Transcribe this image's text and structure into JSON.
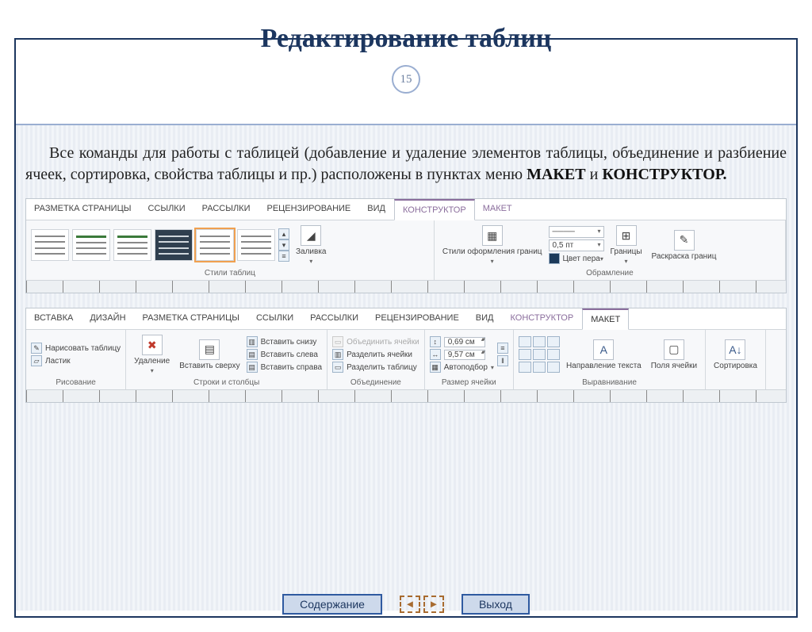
{
  "page_number": "15",
  "title": "Редактирование таблиц",
  "body_pre": "Все команды для работы с таблицей (добавление и удаление элементов таблицы, объединение и разбиение ячеек,  сортировка,  свойства таблицы и пр.) расположены в пунктах меню ",
  "body_bold1": "МАКЕТ",
  "body_mid": " и ",
  "body_bold2": "КОНСТРУКТОР.",
  "shot1": {
    "tabs": [
      "РАЗМЕТКА СТРАНИЦЫ",
      "ССЫЛКИ",
      "РАССЫЛКИ",
      "РЕЦЕНЗИРОВАНИЕ",
      "ВИД",
      "КОНСТРУКТОР",
      "МАКЕТ"
    ],
    "group_styles": "Стили таблиц",
    "fill": "Заливка",
    "border_styles": "Стили оформления границ",
    "pt_value": "0,5 пт",
    "pen_color": "Цвет пера",
    "group_border": "Обрамление",
    "borders": "Границы",
    "paint": "Раскраска границ"
  },
  "shot2": {
    "tabs": [
      "ВСТАВКА",
      "ДИЗАЙН",
      "РАЗМЕТКА СТРАНИЦЫ",
      "ССЫЛКИ",
      "РАССЫЛКИ",
      "РЕЦЕНЗИРОВАНИЕ",
      "ВИД",
      "КОНСТРУКТОР",
      "МАКЕТ"
    ],
    "draw_table": "Нарисовать таблицу",
    "eraser": "Ластик",
    "group_draw": "Рисование",
    "delete": "Удаление",
    "insert_above": "Вставить сверху",
    "insert_below": "Вставить снизу",
    "insert_left": "Вставить слева",
    "insert_right": "Вставить справа",
    "group_rows": "Строки и столбцы",
    "merge": "Объединить ячейки",
    "split": "Разделить ячейки",
    "split_table": "Разделить таблицу",
    "group_merge": "Объединение",
    "height": "0,69 см",
    "width": "9,57 см",
    "autofit": "Автоподбор",
    "group_size": "Размер ячейки",
    "text_dir": "Направление текста",
    "margins": "Поля ячейки",
    "group_align": "Выравнивание",
    "sort": "Сортировка"
  },
  "footer": {
    "contents": "Содержание",
    "exit": "Выход"
  }
}
